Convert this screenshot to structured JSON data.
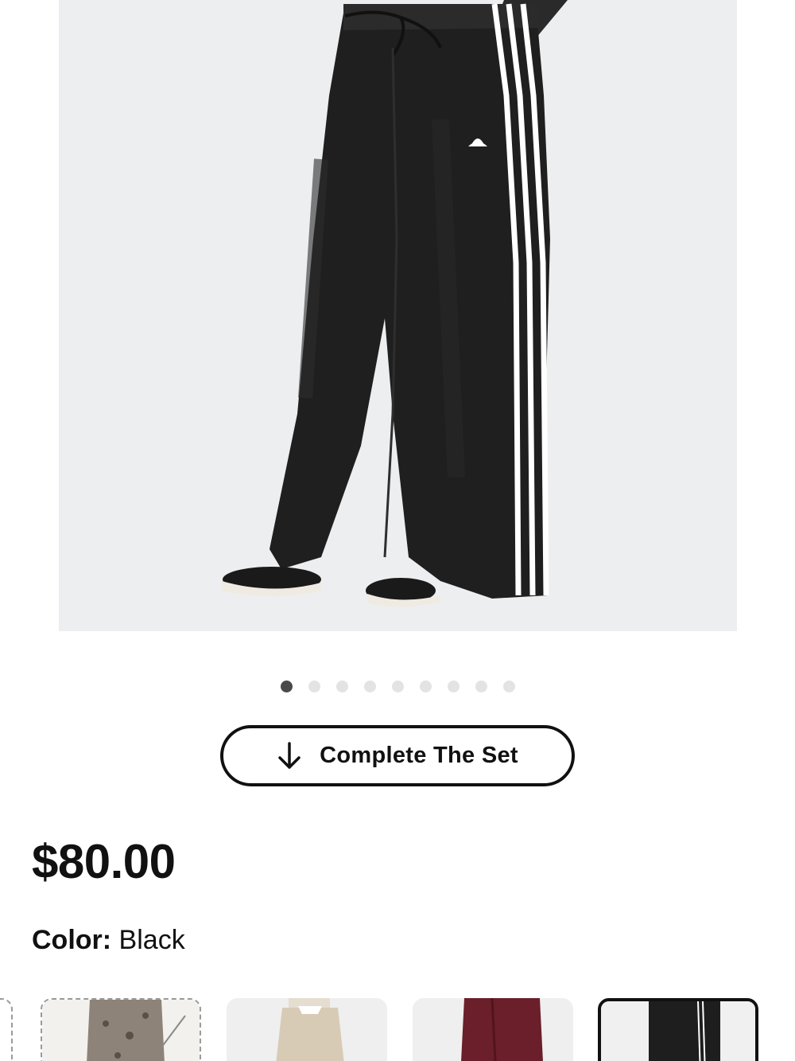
{
  "gallery": {
    "image_alt": "Black wide leg track pants with three white side stripes",
    "dots_count": 9,
    "active_index": 0
  },
  "set_button": {
    "label": "Complete The Set"
  },
  "product": {
    "price": "$80.00"
  },
  "color": {
    "label": "Color:",
    "value": "Black"
  },
  "swatches": [
    {
      "name": "grey-leopard",
      "selected": false,
      "dashed": true
    },
    {
      "name": "beige",
      "selected": false,
      "dashed": false
    },
    {
      "name": "burgundy",
      "selected": false,
      "dashed": false
    },
    {
      "name": "black",
      "selected": true,
      "dashed": false
    }
  ]
}
